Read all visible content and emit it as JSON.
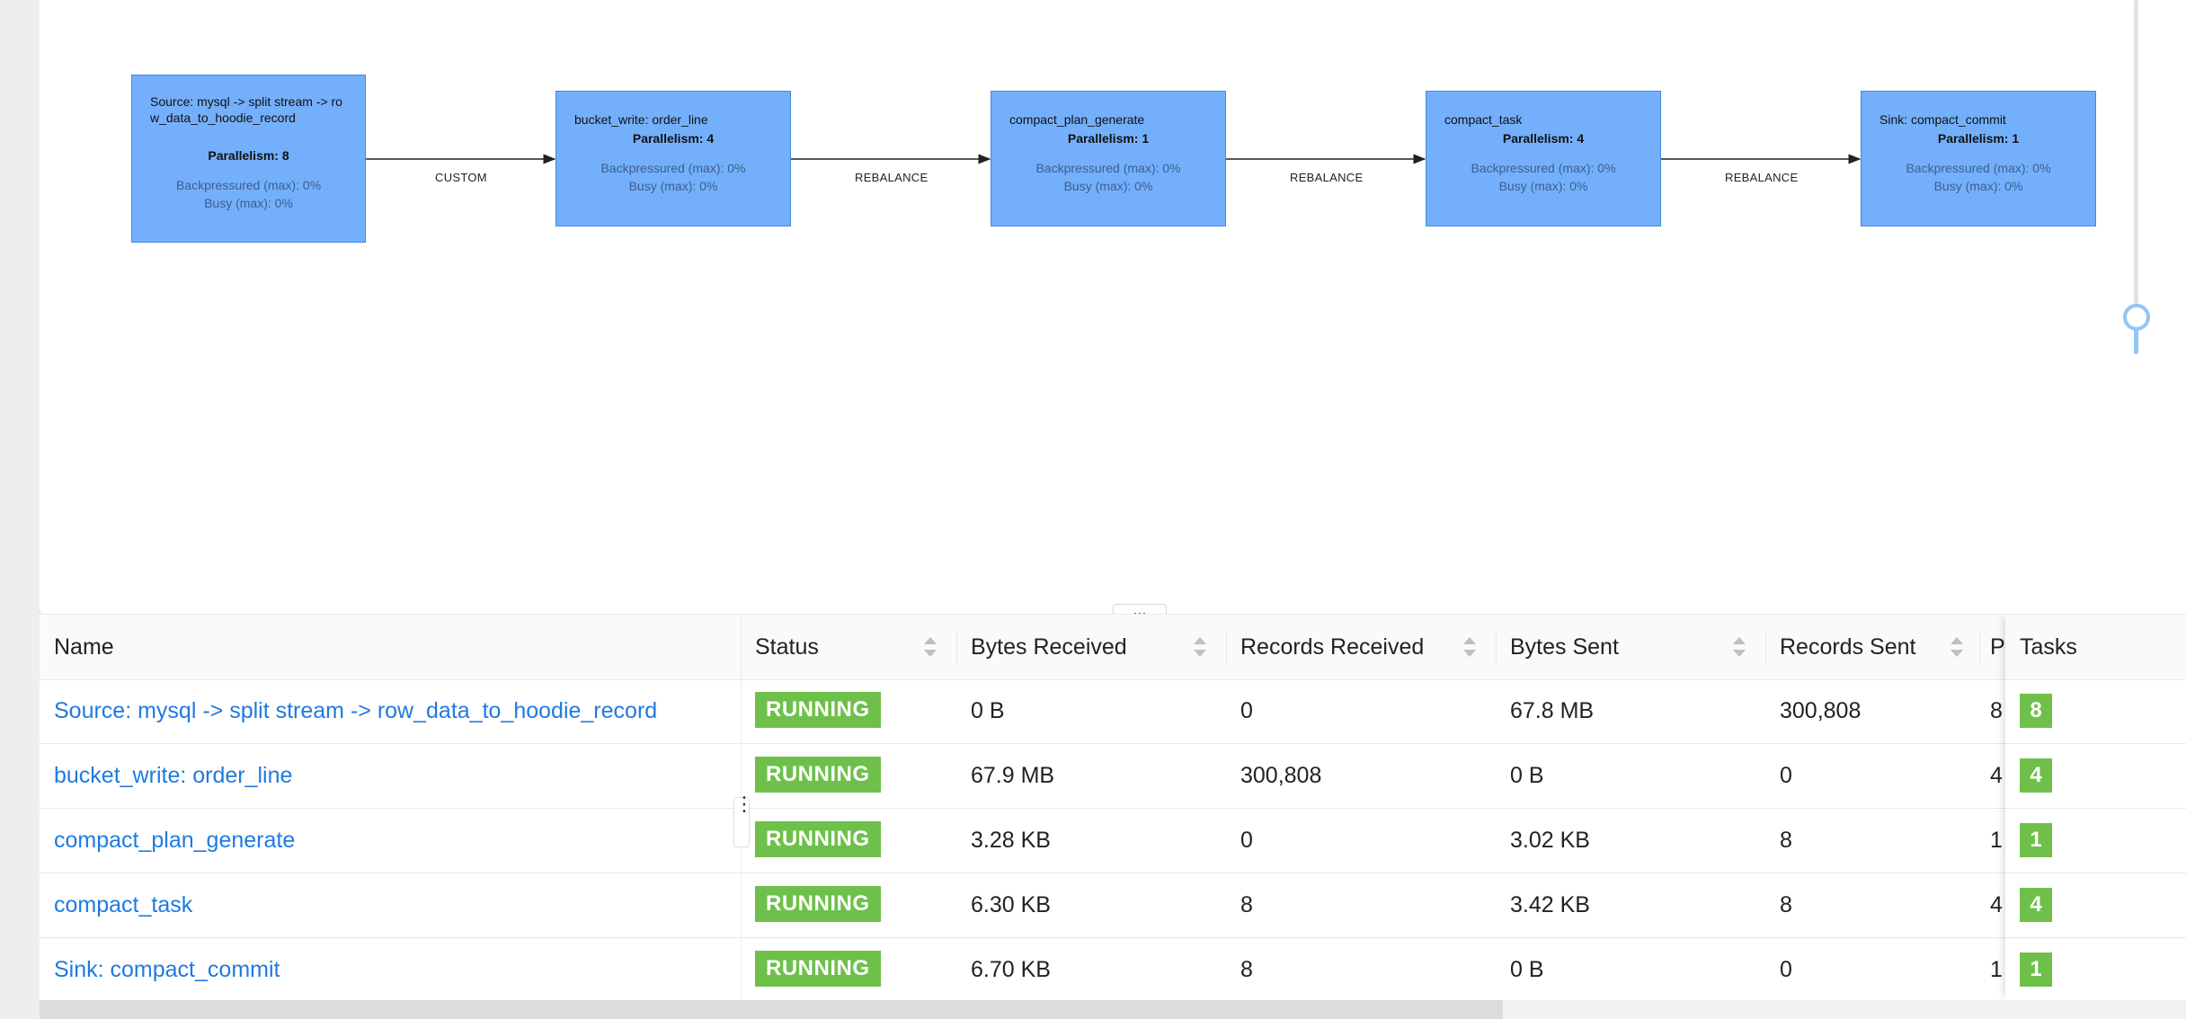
{
  "graph": {
    "nodes": [
      {
        "name": "Source: mysql -> split stream -> row_data_to_hoodie_record",
        "parallelism": "Parallelism: 8",
        "backpressured": "Backpressured (max): 0%",
        "busy": "Busy (max): 0%"
      },
      {
        "name": "bucket_write: order_line",
        "parallelism": "Parallelism: 4",
        "backpressured": "Backpressured (max): 0%",
        "busy": "Busy (max): 0%"
      },
      {
        "name": "compact_plan_generate",
        "parallelism": "Parallelism: 1",
        "backpressured": "Backpressured (max): 0%",
        "busy": "Busy (max): 0%"
      },
      {
        "name": "compact_task",
        "parallelism": "Parallelism: 4",
        "backpressured": "Backpressured (max): 0%",
        "busy": "Busy (max): 0%"
      },
      {
        "name": "Sink: compact_commit",
        "parallelism": "Parallelism: 1",
        "backpressured": "Backpressured (max): 0%",
        "busy": "Busy (max): 0%"
      }
    ],
    "edges": [
      "CUSTOM",
      "REBALANCE",
      "REBALANCE",
      "REBALANCE"
    ]
  },
  "split_handle": "...",
  "table": {
    "columns": {
      "name": "Name",
      "status": "Status",
      "bytes_received": "Bytes Received",
      "records_received": "Records Received",
      "bytes_sent": "Bytes Sent",
      "records_sent": "Records Sent",
      "parallelism_trunc": "P",
      "tasks": "Tasks"
    },
    "rows": [
      {
        "name": "Source: mysql -> split stream -> row_data_to_hoodie_record",
        "status": "RUNNING",
        "bytes_received": "0 B",
        "records_received": "0",
        "bytes_sent": "67.8 MB",
        "records_sent": "300,808",
        "parallelism": "8",
        "tasks": "8"
      },
      {
        "name": "bucket_write: order_line",
        "status": "RUNNING",
        "bytes_received": "67.9 MB",
        "records_received": "300,808",
        "bytes_sent": "0 B",
        "records_sent": "0",
        "parallelism": "4",
        "tasks": "4"
      },
      {
        "name": "compact_plan_generate",
        "status": "RUNNING",
        "bytes_received": "3.28 KB",
        "records_received": "0",
        "bytes_sent": "3.02 KB",
        "records_sent": "8",
        "parallelism": "1",
        "tasks": "1"
      },
      {
        "name": "compact_task",
        "status": "RUNNING",
        "bytes_received": "6.30 KB",
        "records_received": "8",
        "bytes_sent": "3.42 KB",
        "records_sent": "8",
        "parallelism": "4",
        "tasks": "4"
      },
      {
        "name": "Sink: compact_commit",
        "status": "RUNNING",
        "bytes_received": "6.70 KB",
        "records_received": "8",
        "bytes_sent": "0 B",
        "records_sent": "0",
        "parallelism": "1",
        "tasks": "1"
      }
    ]
  },
  "colors": {
    "node_fill": "#74affb",
    "running": "#6ec04b",
    "link": "#1f7ae0"
  }
}
